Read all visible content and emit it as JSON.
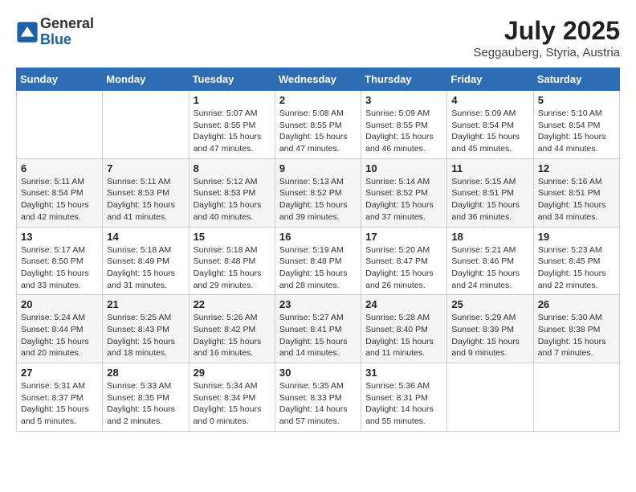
{
  "header": {
    "logo_general": "General",
    "logo_blue": "Blue",
    "month_year": "July 2025",
    "location": "Seggauberg, Styria, Austria"
  },
  "days_of_week": [
    "Sunday",
    "Monday",
    "Tuesday",
    "Wednesday",
    "Thursday",
    "Friday",
    "Saturday"
  ],
  "weeks": [
    [
      {
        "day": "",
        "detail": ""
      },
      {
        "day": "",
        "detail": ""
      },
      {
        "day": "1",
        "detail": "Sunrise: 5:07 AM\nSunset: 8:55 PM\nDaylight: 15 hours\nand 47 minutes."
      },
      {
        "day": "2",
        "detail": "Sunrise: 5:08 AM\nSunset: 8:55 PM\nDaylight: 15 hours\nand 47 minutes."
      },
      {
        "day": "3",
        "detail": "Sunrise: 5:09 AM\nSunset: 8:55 PM\nDaylight: 15 hours\nand 46 minutes."
      },
      {
        "day": "4",
        "detail": "Sunrise: 5:09 AM\nSunset: 8:54 PM\nDaylight: 15 hours\nand 45 minutes."
      },
      {
        "day": "5",
        "detail": "Sunrise: 5:10 AM\nSunset: 8:54 PM\nDaylight: 15 hours\nand 44 minutes."
      }
    ],
    [
      {
        "day": "6",
        "detail": "Sunrise: 5:11 AM\nSunset: 8:54 PM\nDaylight: 15 hours\nand 42 minutes."
      },
      {
        "day": "7",
        "detail": "Sunrise: 5:11 AM\nSunset: 8:53 PM\nDaylight: 15 hours\nand 41 minutes."
      },
      {
        "day": "8",
        "detail": "Sunrise: 5:12 AM\nSunset: 8:53 PM\nDaylight: 15 hours\nand 40 minutes."
      },
      {
        "day": "9",
        "detail": "Sunrise: 5:13 AM\nSunset: 8:52 PM\nDaylight: 15 hours\nand 39 minutes."
      },
      {
        "day": "10",
        "detail": "Sunrise: 5:14 AM\nSunset: 8:52 PM\nDaylight: 15 hours\nand 37 minutes."
      },
      {
        "day": "11",
        "detail": "Sunrise: 5:15 AM\nSunset: 8:51 PM\nDaylight: 15 hours\nand 36 minutes."
      },
      {
        "day": "12",
        "detail": "Sunrise: 5:16 AM\nSunset: 8:51 PM\nDaylight: 15 hours\nand 34 minutes."
      }
    ],
    [
      {
        "day": "13",
        "detail": "Sunrise: 5:17 AM\nSunset: 8:50 PM\nDaylight: 15 hours\nand 33 minutes."
      },
      {
        "day": "14",
        "detail": "Sunrise: 5:18 AM\nSunset: 8:49 PM\nDaylight: 15 hours\nand 31 minutes."
      },
      {
        "day": "15",
        "detail": "Sunrise: 5:18 AM\nSunset: 8:48 PM\nDaylight: 15 hours\nand 29 minutes."
      },
      {
        "day": "16",
        "detail": "Sunrise: 5:19 AM\nSunset: 8:48 PM\nDaylight: 15 hours\nand 28 minutes."
      },
      {
        "day": "17",
        "detail": "Sunrise: 5:20 AM\nSunset: 8:47 PM\nDaylight: 15 hours\nand 26 minutes."
      },
      {
        "day": "18",
        "detail": "Sunrise: 5:21 AM\nSunset: 8:46 PM\nDaylight: 15 hours\nand 24 minutes."
      },
      {
        "day": "19",
        "detail": "Sunrise: 5:23 AM\nSunset: 8:45 PM\nDaylight: 15 hours\nand 22 minutes."
      }
    ],
    [
      {
        "day": "20",
        "detail": "Sunrise: 5:24 AM\nSunset: 8:44 PM\nDaylight: 15 hours\nand 20 minutes."
      },
      {
        "day": "21",
        "detail": "Sunrise: 5:25 AM\nSunset: 8:43 PM\nDaylight: 15 hours\nand 18 minutes."
      },
      {
        "day": "22",
        "detail": "Sunrise: 5:26 AM\nSunset: 8:42 PM\nDaylight: 15 hours\nand 16 minutes."
      },
      {
        "day": "23",
        "detail": "Sunrise: 5:27 AM\nSunset: 8:41 PM\nDaylight: 15 hours\nand 14 minutes."
      },
      {
        "day": "24",
        "detail": "Sunrise: 5:28 AM\nSunset: 8:40 PM\nDaylight: 15 hours\nand 11 minutes."
      },
      {
        "day": "25",
        "detail": "Sunrise: 5:29 AM\nSunset: 8:39 PM\nDaylight: 15 hours\nand 9 minutes."
      },
      {
        "day": "26",
        "detail": "Sunrise: 5:30 AM\nSunset: 8:38 PM\nDaylight: 15 hours\nand 7 minutes."
      }
    ],
    [
      {
        "day": "27",
        "detail": "Sunrise: 5:31 AM\nSunset: 8:37 PM\nDaylight: 15 hours\nand 5 minutes."
      },
      {
        "day": "28",
        "detail": "Sunrise: 5:33 AM\nSunset: 8:35 PM\nDaylight: 15 hours\nand 2 minutes."
      },
      {
        "day": "29",
        "detail": "Sunrise: 5:34 AM\nSunset: 8:34 PM\nDaylight: 15 hours\nand 0 minutes."
      },
      {
        "day": "30",
        "detail": "Sunrise: 5:35 AM\nSunset: 8:33 PM\nDaylight: 14 hours\nand 57 minutes."
      },
      {
        "day": "31",
        "detail": "Sunrise: 5:36 AM\nSunset: 8:31 PM\nDaylight: 14 hours\nand 55 minutes."
      },
      {
        "day": "",
        "detail": ""
      },
      {
        "day": "",
        "detail": ""
      }
    ]
  ]
}
